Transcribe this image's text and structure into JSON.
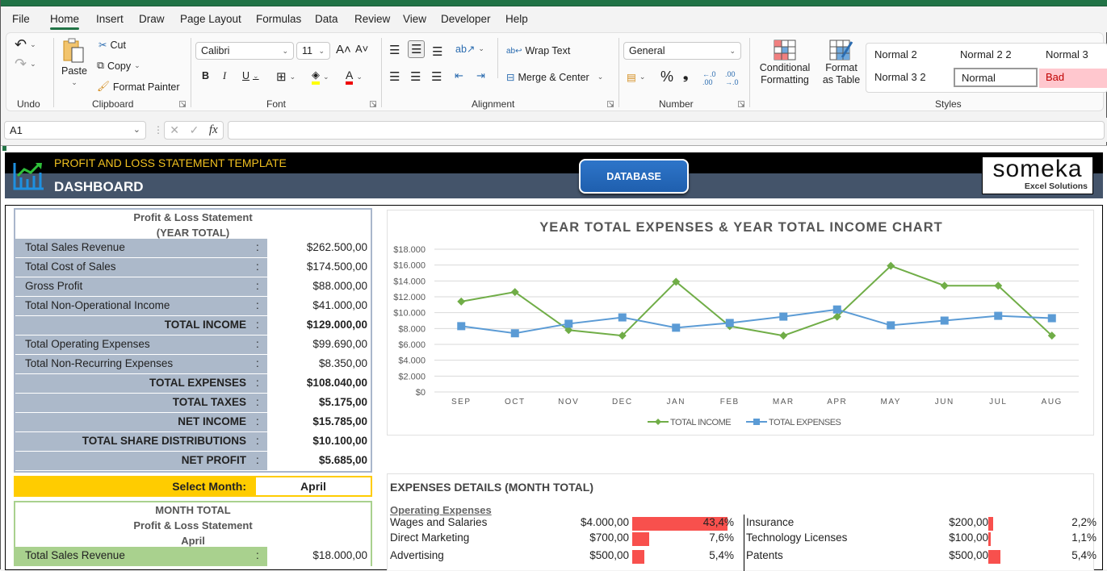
{
  "menu": {
    "tabs": [
      "File",
      "Home",
      "Insert",
      "Draw",
      "Page Layout",
      "Formulas",
      "Data",
      "Review",
      "View",
      "Developer",
      "Help"
    ],
    "active": "Home"
  },
  "ribbon": {
    "undo_label": "Undo",
    "clipboard": {
      "paste": "Paste",
      "cut": "Cut",
      "copy": "Copy",
      "format_painter": "Format Painter",
      "label": "Clipboard"
    },
    "font": {
      "family": "Calibri",
      "size": "11",
      "label": "Font",
      "bold": "B",
      "italic": "I",
      "underline": "U"
    },
    "alignment": {
      "wrap_text": "Wrap Text",
      "merge_center": "Merge & Center",
      "label": "Alignment"
    },
    "number": {
      "format": "General",
      "percent": "%",
      "comma": "❩",
      "label": "Number"
    },
    "styles": {
      "conditional_formatting": "Conditional Formatting",
      "format_as_table": "Format as Table",
      "items": [
        "Normal 2",
        "Normal 2 2",
        "Normal 3",
        "Normal 3 2",
        "Normal",
        "Bad"
      ],
      "label": "Styles"
    }
  },
  "formula_bar": {
    "name_box": "A1",
    "fx": "fx",
    "formula": ""
  },
  "header": {
    "title": "PROFIT AND LOSS STATEMENT TEMPLATE",
    "subtitle": "DASHBOARD",
    "database_button": "DATABASE",
    "logo_main": "someka",
    "logo_sub": "Excel Solutions"
  },
  "year_statement": {
    "title_line1": "Profit & Loss Statement",
    "title_line2": "(YEAR TOTAL)",
    "rows": [
      {
        "label": "Total Sales Revenue",
        "value": "$262.500,00",
        "bold": false
      },
      {
        "label": "Total Cost of Sales",
        "value": "$174.500,00",
        "bold": false
      },
      {
        "label": "Gross Profit",
        "value": "$88.000,00",
        "bold": false
      },
      {
        "label": "Total Non-Operational Income",
        "value": "$41.000,00",
        "bold": false
      },
      {
        "label": "TOTAL INCOME",
        "value": "$129.000,00",
        "bold": true
      },
      {
        "label": "Total Operating Expenses",
        "value": "$99.690,00",
        "bold": false
      },
      {
        "label": "Total Non-Recurring Expenses",
        "value": "$8.350,00",
        "bold": false
      },
      {
        "label": "TOTAL EXPENSES",
        "value": "$108.040,00",
        "bold": true
      },
      {
        "label": "TOTAL TAXES",
        "value": "$5.175,00",
        "bold": true
      },
      {
        "label": "NET INCOME",
        "value": "$15.785,00",
        "bold": true
      },
      {
        "label": "TOTAL SHARE DISTRIBUTIONS",
        "value": "$10.100,00",
        "bold": true
      },
      {
        "label": "NET PROFIT",
        "value": "$5.685,00",
        "bold": true
      }
    ]
  },
  "select_month": {
    "label": "Select Month:",
    "value": "April"
  },
  "month_statement": {
    "title_line1": "MONTH TOTAL",
    "title_line2": "Profit & Loss Statement",
    "title_line3": "April",
    "rows": [
      {
        "label": "Total Sales Revenue",
        "value": "$18.000,00"
      }
    ]
  },
  "chart_data": {
    "type": "line",
    "title": "YEAR TOTAL EXPENSES & YEAR TOTAL INCOME CHART",
    "categories": [
      "SEP",
      "OCT",
      "NOV",
      "DEC",
      "JAN",
      "FEB",
      "MAR",
      "APR",
      "MAY",
      "JUN",
      "JUL",
      "AUG"
    ],
    "series": [
      {
        "name": "TOTAL INCOME",
        "color": "#70ad47",
        "marker": "diamond",
        "values": [
          11400,
          12600,
          7800,
          7100,
          13900,
          8300,
          7100,
          9500,
          15900,
          13400,
          13400,
          7100
        ]
      },
      {
        "name": "TOTAL EXPENSES",
        "color": "#5b9bd5",
        "marker": "square",
        "values": [
          8300,
          7400,
          8600,
          9400,
          8100,
          8700,
          9500,
          10400,
          8400,
          9000,
          9600,
          9300
        ]
      }
    ],
    "yticks": [
      "$0",
      "$2.000",
      "$4.000",
      "$6.000",
      "$8.000",
      "$10.000",
      "$12.000",
      "$14.000",
      "$16.000",
      "$18.000"
    ],
    "ylim": [
      0,
      18000
    ],
    "xlabel": "",
    "ylabel": "",
    "grid": true,
    "legend": "bottom"
  },
  "expenses": {
    "title": "EXPENSES DETAILS (MONTH TOTAL)",
    "section": "Operating Expenses",
    "left": [
      {
        "name": "Wages and Salaries",
        "amount": "$4.000,00",
        "pct": "43,4%",
        "share": 0.434
      },
      {
        "name": "Direct Marketing",
        "amount": "$700,00",
        "pct": "7,6%",
        "share": 0.076
      },
      {
        "name": "Advertising",
        "amount": "$500,00",
        "pct": "5,4%",
        "share": 0.054
      }
    ],
    "right": [
      {
        "name": "Insurance",
        "amount": "$200,00",
        "pct": "2,2%",
        "share": 0.022
      },
      {
        "name": "Technology Licenses",
        "amount": "$100,00",
        "pct": "1,1%",
        "share": 0.011
      },
      {
        "name": "Patents",
        "amount": "$500,00",
        "pct": "5,4%",
        "share": 0.054
      }
    ],
    "bar_color": "#f8504d"
  }
}
